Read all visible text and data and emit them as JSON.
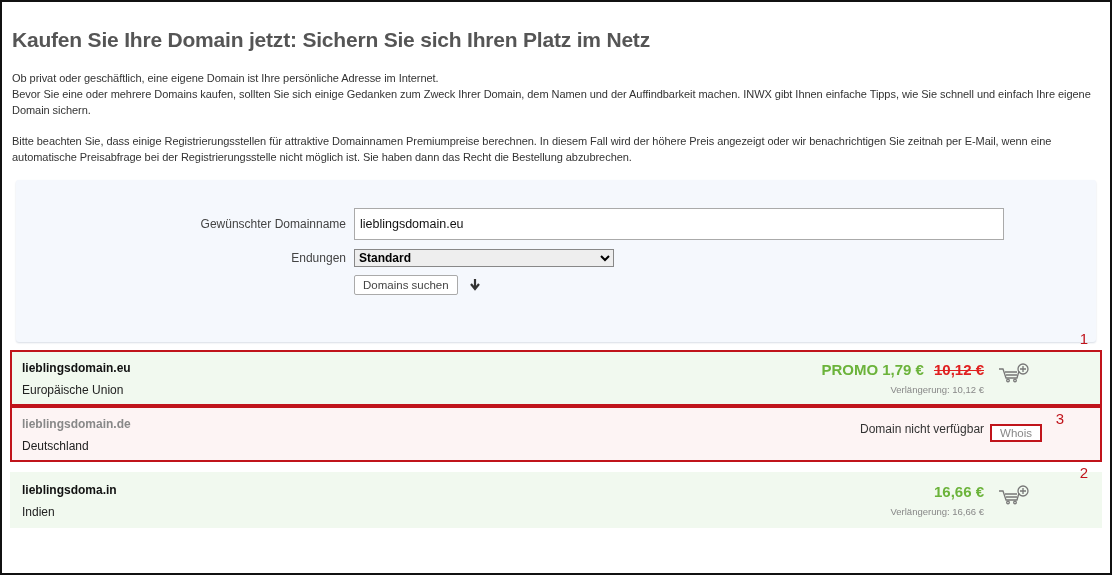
{
  "title": "Kaufen Sie Ihre Domain jetzt: Sichern Sie sich Ihren Platz im Netz",
  "intro": [
    "Ob privat oder geschäftlich, eine eigene Domain ist Ihre persönliche Adresse im Internet.\nBevor Sie eine oder mehrere Domains kaufen, sollten Sie sich einige Gedanken zum Zweck Ihrer Domain, dem Namen und der Auffindbarkeit machen. INWX gibt Ihnen einfache Tipps, wie Sie schnell und einfach Ihre eigene Domain sichern.",
    "Bitte beachten Sie, dass einige Registrierungsstellen für attraktive Domainnamen Premiumpreise berechnen. In diesem Fall wird der höhere Preis angezeigt oder wir benachrichtigen Sie zeitnah per E-Mail, wenn eine automatische Preisabfrage bei der Registrierungsstelle nicht möglich ist. Sie haben dann das Recht die Bestellung abzubrechen."
  ],
  "search": {
    "name_label": "Gewünschter Domainname",
    "name_value": "lieblingsdomain.eu",
    "ext_label": "Endungen",
    "ext_value": "Standard",
    "button": "Domains suchen"
  },
  "results": [
    {
      "kind": "available",
      "domain": "lieblingsdomain.eu",
      "country": "Europäische Union",
      "price": "PROMO 1,79 €",
      "old_price": "10,12 €",
      "renewal": "Verlängerung: 10,12 €",
      "callout": "1",
      "callout_below": false
    },
    {
      "kind": "unavailable",
      "domain": "lieblingsdomain.de",
      "country": "Deutschland",
      "status": "Domain nicht verfügbar",
      "button": "Whois",
      "button_callout": "3",
      "callout": "2",
      "callout_below": true
    },
    {
      "kind": "available",
      "domain": "lieblingsdoma.in",
      "country": "Indien",
      "price": "16,66 €",
      "renewal": "Verlängerung: 16,66 €"
    }
  ]
}
